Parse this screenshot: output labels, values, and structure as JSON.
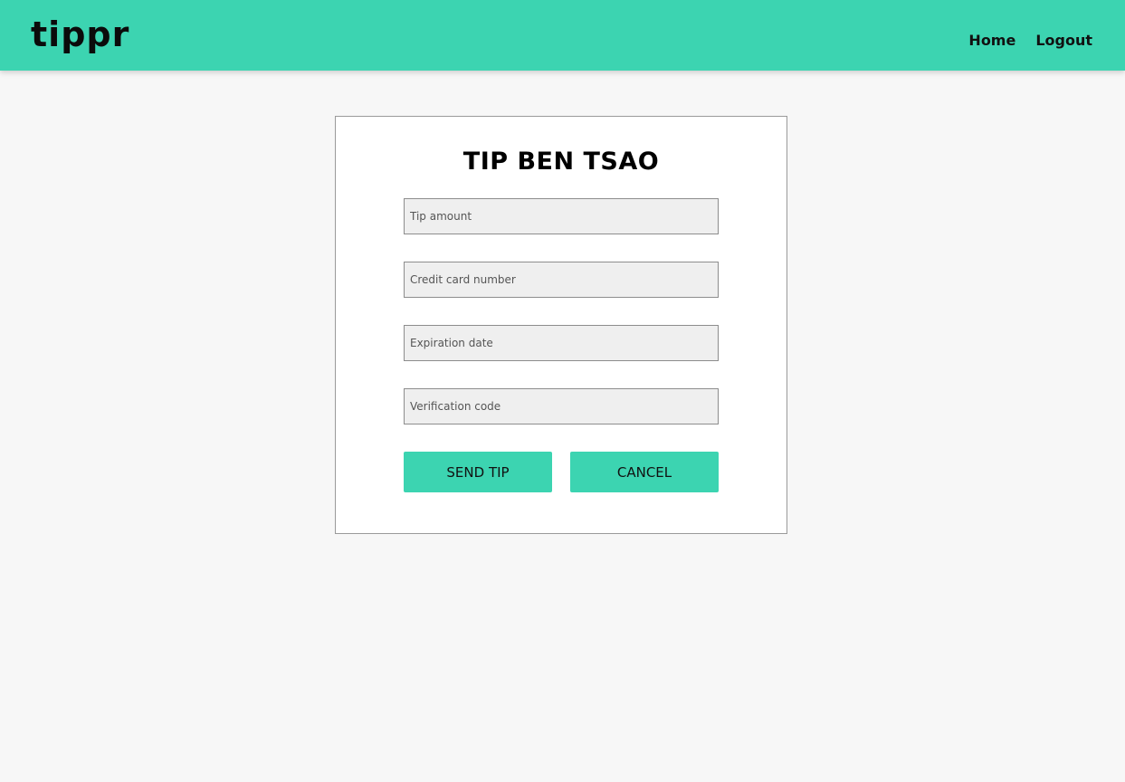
{
  "navbar": {
    "logo": "tippr",
    "links": [
      {
        "label": "Home"
      },
      {
        "label": "Logout"
      }
    ]
  },
  "form": {
    "title": "TIP BEN TSAO",
    "fields": [
      {
        "placeholder": "Tip amount",
        "value": ""
      },
      {
        "placeholder": "Credit card number",
        "value": ""
      },
      {
        "placeholder": "Expiration date",
        "value": ""
      },
      {
        "placeholder": "Verification code",
        "value": ""
      }
    ],
    "send_label": "SEND TIP",
    "cancel_label": "CANCEL"
  },
  "colors": {
    "accent": "#3cd4b1",
    "background": "#f7f7f7",
    "field_background": "#efefef"
  }
}
